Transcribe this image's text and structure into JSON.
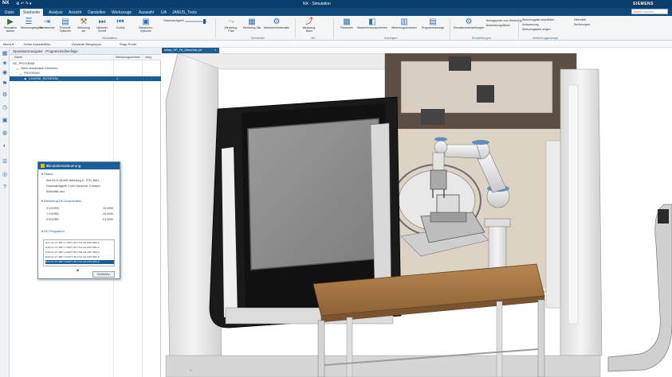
{
  "titlebar": {
    "logo": "NX",
    "quick_access": "⚙ ↶ ↷ ▾",
    "title": "NX - Simulation",
    "brand": "SIEMENS"
  },
  "tabs": [
    {
      "label": "Datei"
    },
    {
      "label": "Startseite"
    },
    {
      "label": "Analyse"
    },
    {
      "label": "Ansicht"
    },
    {
      "label": "Darstellen"
    },
    {
      "label": "Werkzeuge"
    },
    {
      "label": "Auswahl"
    },
    {
      "label": "UA"
    },
    {
      "label": "JANUS_Tools"
    }
  ],
  "search": {
    "placeholder": "Befehl suchen"
  },
  "ribbon": {
    "buttons": [
      {
        "label": "Simulation starten",
        "icon": "play-icon"
      },
      {
        "label": "Werkzeugwegliste",
        "icon": "list-icon"
      },
      {
        "label": "Schrittweise",
        "icon": "step-icon"
      },
      {
        "label": "Protokoll-Optionen",
        "icon": "protocol-icon"
      },
      {
        "label": "Werkzeug ein",
        "icon": "tool-icon"
      },
      {
        "label": "Nächster Schritt",
        "icon": "next-icon"
      },
      {
        "label": "Zurück",
        "icon": "back-icon"
      },
      {
        "label": "Maschinen-Optionen",
        "icon": "machine-icon"
      }
    ],
    "group_simulation": "Simulation",
    "speed_label": "Geschwindigkeit",
    "buttons2": [
      {
        "label": "Werkzeug-Pfad",
        "icon": "path-icon"
      },
      {
        "label": "Werkzeug-Tab",
        "icon": "tab-icon"
      },
      {
        "label": "Maschinenkinematik",
        "icon": "kinematic-icon"
      },
      {
        "label": "Werkzeug-Bahn",
        "icon": "track-icon"
      },
      {
        "label": "Parameter",
        "icon": "parameter-icon"
      },
      {
        "label": "Maschinenkomponenten",
        "icon": "components-icon"
      },
      {
        "label": "Werkzeugschranken",
        "icon": "cabinet-icon"
      },
      {
        "label": "Programmanzeige",
        "icon": "program-icon"
      },
      {
        "label": "Simulationseinstellungen",
        "icon": "settings-icon"
      },
      {
        "label": "Ansicht",
        "icon": "view-icon"
      }
    ],
    "group_cabinets": "Schränke",
    "group_nc": "NC",
    "group_info": "Anzeigen",
    "group_settings": "Einstellungen",
    "group_view": "Werkzeuganzeige",
    "mini_items": [
      "Bezugspunkt zum Werkzeug",
      "Bearbeitungsfläche",
      "Werkzeugpfad auswählen",
      "Aufspannung",
      "Werkzeugstand zeigen",
      "Hilfsmittel",
      "Berührungen"
    ]
  },
  "toolbar2": {
    "items": [
      "Menü ▾",
      "Keine Auswahlfilter",
      "Gesamte Baugruppe",
      "Snap-Punkt"
    ]
  },
  "navigator": {
    "title": "Operationsnavigator - Programmreihenfolge",
    "col_name": "Name",
    "col_tool": "Werkzeugwechsel",
    "col_path": "Weg",
    "rows": [
      {
        "label": "NC_PROGRAM",
        "value": "",
        "check": ""
      },
      {
        "label": "Nicht verwendete Elemente",
        "value": "",
        "check": ""
      },
      {
        "label": "PROGRAM",
        "value": "",
        "check": ""
      },
      {
        "label": "CHASSE_ROTATION",
        "value": "1",
        "check": "✓ ✓"
      }
    ]
  },
  "dialog": {
    "title": "Simulationssteuerung",
    "close": "×",
    "sec_status": "Status",
    "status_lines": [
      "Zeit 00:21:06.609    Werkzeug 6 : STD_BALL",
      "Geschwindigkeit: 0 rpm  Vorschub: 0 mmpm",
      "Kühlmittel: aus"
    ],
    "sec_axes": "Werkzeug DK-Koordinaten",
    "axes": [
      {
        "name": "X KOORD",
        "value": "33.9999"
      },
      {
        "name": "Y KOORD",
        "value": "-34.0000"
      },
      {
        "name": "Z KOORD",
        "value": "4.3.0000"
      }
    ],
    "sec_nc": "NC-Programm",
    "nc_lines": [
      "N17 G1 X7.466 Y-7.0677 Z9.7711 A0.1357 B34.6",
      "N18 G1 X7.466 Y-7.0677 Z9.7711 A0.1357 B34.6",
      "N19 G1 X7.466 Y-6.9677 Z9.7701 A0.1357 B34.6",
      "N20 G1 X7.466 Y-6.9677 Z9.7711 A0.1357 B34.6",
      "N21 G1 X7.466 Y-6.9677 Z9.7711 A0.1357 B34.6"
    ],
    "close_button": "Schließen"
  },
  "viewport": {
    "tab_label": "setup_HP_FA_Maschine.prt",
    "tab_close": "×",
    "triad": "Y"
  },
  "colors": {
    "titlebar": "#0a3d6b",
    "tabbar": "#0f4a7e",
    "accent": "#1a5d97",
    "machine_white": "#f4f4f4",
    "window_glass": "#8c8c8c",
    "table_top": "#a77a45",
    "robot_blue": "#5d8dc3"
  }
}
